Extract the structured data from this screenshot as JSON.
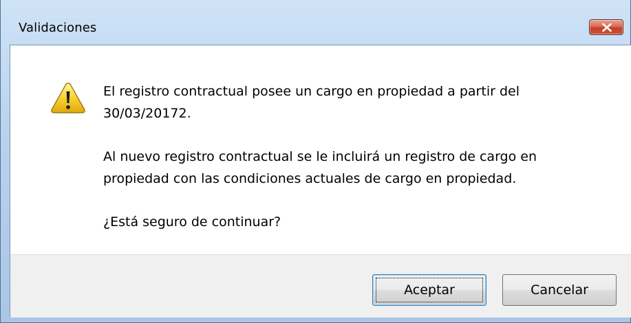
{
  "window": {
    "title": "Validaciones",
    "close_icon": "close-x-icon"
  },
  "dialog": {
    "icon": "warning-icon",
    "message": {
      "paragraph1_line1": "El registro contractual posee un cargo en propiedad a partir del",
      "paragraph1_line2": "30/03/20172.",
      "paragraph2_line1": "Al nuevo registro contractual se le incluirá un registro de cargo en",
      "paragraph2_line2": "propiedad con las condiciones actuales de cargo en propiedad.",
      "question": "¿Está seguro de continuar?"
    }
  },
  "buttons": {
    "accept_label": "Aceptar",
    "cancel_label": "Cancelar"
  },
  "colors": {
    "title_gradient_top": "#cfe3f6",
    "close_button": "#c9523d",
    "footer_background": "#f0f0f0",
    "warning_yellow": "#f6d330"
  }
}
